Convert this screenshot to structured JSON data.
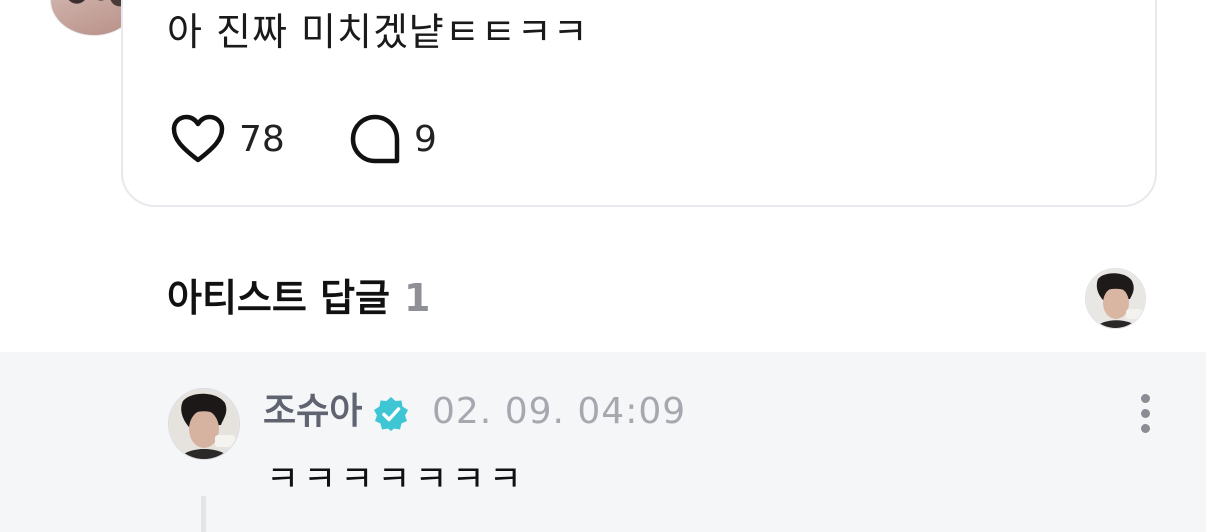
{
  "post": {
    "text": "아 진짜 미치겠냩ㅌㅌㅋㅋ",
    "like_count": "78",
    "comment_count": "9"
  },
  "artist_replies": {
    "title": "아티스트 답글",
    "count": "1"
  },
  "reply": {
    "author": "조슈아",
    "timestamp": "02. 09. 04:09",
    "text": "ㅋㅋㅋㅋㅋㅋㅋ"
  },
  "colors": {
    "verified": "#3fc6d4",
    "reply_background": "#f5f6f8",
    "author_name": "#5f6470",
    "timestamp": "#a5a8ae"
  },
  "icons": [
    "heart-icon",
    "comment-bubble-icon",
    "verified-badge-icon",
    "more-vertical-icon"
  ]
}
